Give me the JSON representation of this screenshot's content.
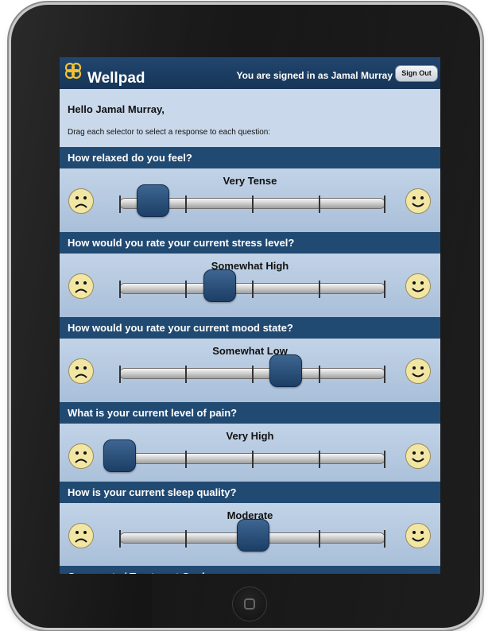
{
  "app": {
    "title": "Wellpad",
    "signed_in_text": "You are signed in as Jamal Murray",
    "sign_out_label": "Sign Out"
  },
  "greeting": "Hello Jamal Murray,",
  "instructions": "Drag each selector to select a response to each question:",
  "questions": [
    {
      "question": "How relaxed do you feel?",
      "response": "Very Tense",
      "slider_position": 0.125
    },
    {
      "question": "How would you rate your current stress level?",
      "response": "Somewhat High",
      "slider_position": 0.375
    },
    {
      "question": "How would you rate your current mood state?",
      "response": "Somewhat Low",
      "slider_position": 0.625
    },
    {
      "question": "What is your current level of pain?",
      "response": "Very High",
      "slider_position": 0.0
    },
    {
      "question": "How is your current sleep quality?",
      "response": "Moderate",
      "slider_position": 0.5
    }
  ],
  "next_section": "Comments / Treatment Goals",
  "icons": {
    "sad": "sad-face-icon",
    "happy": "happy-face-icon",
    "logo": "wellpad-logo-icon"
  },
  "colors": {
    "header": "#214a72",
    "thumb": "#2c5682",
    "face": "#f2e6a4"
  }
}
